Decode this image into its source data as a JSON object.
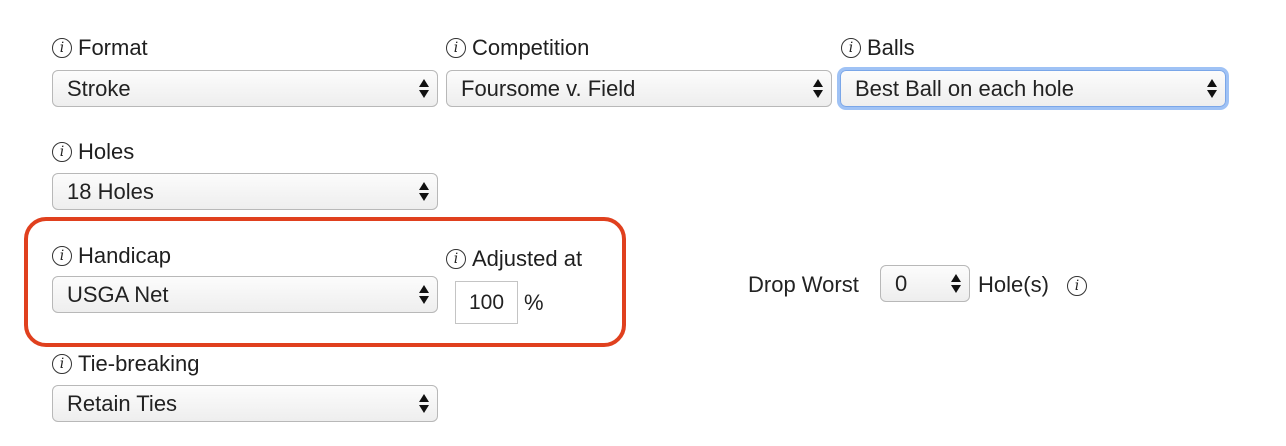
{
  "format": {
    "label": "Format",
    "value": "Stroke"
  },
  "competition": {
    "label": "Competition",
    "value": "Foursome v. Field"
  },
  "balls": {
    "label": "Balls",
    "value": "Best Ball on each hole"
  },
  "holes": {
    "label": "Holes",
    "value": "18 Holes"
  },
  "handicap": {
    "label": "Handicap",
    "value": "USGA Net"
  },
  "adjusted": {
    "label": "Adjusted at",
    "value": "100",
    "unit": "%"
  },
  "drop_worst": {
    "label": "Drop Worst",
    "value": "0",
    "suffix": "Hole(s)"
  },
  "tie_breaking": {
    "label": "Tie-breaking",
    "value": "Retain Ties"
  },
  "info_glyph": "i",
  "colors": {
    "highlight": "#e0401e",
    "focus": "#9fc2f5"
  }
}
